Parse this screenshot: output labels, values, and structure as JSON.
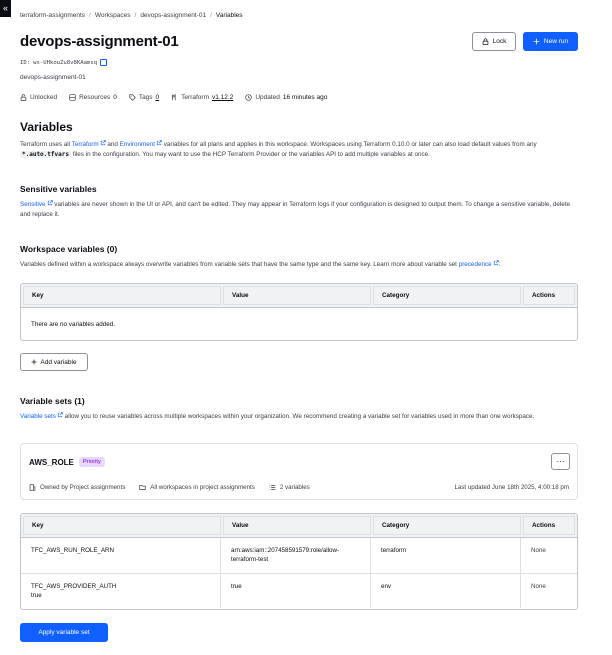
{
  "sidebar_toggle": {
    "glyph": "«"
  },
  "breadcrumb": [
    "terraform-assignments",
    "Workspaces",
    "devops-assignment-01",
    "Variables"
  ],
  "header": {
    "title": "devops-assignment-01",
    "lock_label": "Lock",
    "new_run_label": "New run",
    "id_label": "ID:",
    "id_value": "ws-UHkouZu8v8KAamsq",
    "description": "devops-assignment-01"
  },
  "meta": {
    "lock_status": "Unlocked",
    "resources_label": "Resources",
    "resources_count": "0",
    "tags_label": "Tags",
    "tags_count": "0",
    "terraform_label": "Terraform",
    "terraform_version": "v1.12.2",
    "updated_label": "Updated",
    "updated_value": "16 minutes ago"
  },
  "variables_section": {
    "title": "Variables",
    "p1": "Terraform uses all ",
    "link_terraform": "Terraform",
    "p2": " and ",
    "link_environment": "Environment",
    "p3": " variables for all plans and applies in this workspace. Workspaces using Terraform 0.10.0 or later can also load default values from any ",
    "code": "*.auto.tfvars",
    "p4": " files in the configuration. You may want to use the HCP Terraform Provider or the variables API to add multiple variables at once."
  },
  "sensitive_section": {
    "title": "Sensitive variables",
    "link": "Sensitive",
    "text": " variables are never shown in the UI or API, and can't be edited. They may appear in Terraform logs if your configuration is designed to output them. To change a sensitive variable, delete and replace it."
  },
  "workspace_vars": {
    "title": "Workspace variables (0)",
    "text": "Variables defined within a workspace always overwrite variables from variable sets that have the same type and the same key. Learn more about variable set ",
    "link": "precedence",
    "trailing": ".",
    "columns": [
      "Key",
      "Value",
      "Category",
      "Actions"
    ],
    "empty_text": "There are no variables added.",
    "add_label": "Add variable"
  },
  "variable_sets": {
    "title": "Variable sets (1)",
    "link": "Variable sets",
    "text": " allow you to reuse variables across multiple workspaces within your organization. We recommend creating a variable set for variables used in more than one workspace.",
    "card": {
      "name": "AWS_ROLE",
      "badge": "Priority",
      "more": "···",
      "owner": "Owned by Project assignments",
      "scope": "All workspaces in project assignments",
      "count": "2 variables",
      "updated": "Last updated June 18th 2025, 4:00:18 pm"
    },
    "columns": [
      "Key",
      "Value",
      "Category",
      "Actions"
    ],
    "rows": [
      {
        "key": "TFC_AWS_RUN_ROLE_ARN",
        "value_l1": "arn:aws:iam::207458591579:role/allow-",
        "value_l2": "terraform-test",
        "category": "terraform",
        "actions": "None"
      },
      {
        "key_l1": "TFC_AWS_PROVIDER_AUTH",
        "key_l2": "true",
        "value": "true",
        "category": "env",
        "actions": "None"
      }
    ],
    "apply_label": "Apply variable set"
  },
  "colors": {
    "accent": "#1060ff",
    "text": "#0b0d12",
    "muted": "#3b3d45",
    "badge_bg": "#e9d8fd",
    "badge_fg": "#7b00db"
  }
}
